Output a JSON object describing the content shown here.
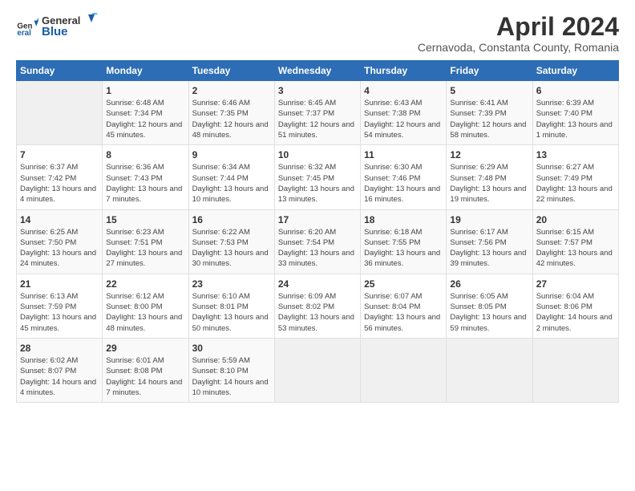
{
  "header": {
    "logo_general": "General",
    "logo_blue": "Blue",
    "month_title": "April 2024",
    "location": "Cernavoda, Constanta County, Romania"
  },
  "days_of_week": [
    "Sunday",
    "Monday",
    "Tuesday",
    "Wednesday",
    "Thursday",
    "Friday",
    "Saturday"
  ],
  "weeks": [
    [
      {
        "day": "",
        "sunrise": "",
        "sunset": "",
        "daylight": "",
        "empty": true
      },
      {
        "day": "1",
        "sunrise": "Sunrise: 6:48 AM",
        "sunset": "Sunset: 7:34 PM",
        "daylight": "Daylight: 12 hours and 45 minutes."
      },
      {
        "day": "2",
        "sunrise": "Sunrise: 6:46 AM",
        "sunset": "Sunset: 7:35 PM",
        "daylight": "Daylight: 12 hours and 48 minutes."
      },
      {
        "day": "3",
        "sunrise": "Sunrise: 6:45 AM",
        "sunset": "Sunset: 7:37 PM",
        "daylight": "Daylight: 12 hours and 51 minutes."
      },
      {
        "day": "4",
        "sunrise": "Sunrise: 6:43 AM",
        "sunset": "Sunset: 7:38 PM",
        "daylight": "Daylight: 12 hours and 54 minutes."
      },
      {
        "day": "5",
        "sunrise": "Sunrise: 6:41 AM",
        "sunset": "Sunset: 7:39 PM",
        "daylight": "Daylight: 12 hours and 58 minutes."
      },
      {
        "day": "6",
        "sunrise": "Sunrise: 6:39 AM",
        "sunset": "Sunset: 7:40 PM",
        "daylight": "Daylight: 13 hours and 1 minute."
      }
    ],
    [
      {
        "day": "7",
        "sunrise": "Sunrise: 6:37 AM",
        "sunset": "Sunset: 7:42 PM",
        "daylight": "Daylight: 13 hours and 4 minutes."
      },
      {
        "day": "8",
        "sunrise": "Sunrise: 6:36 AM",
        "sunset": "Sunset: 7:43 PM",
        "daylight": "Daylight: 13 hours and 7 minutes."
      },
      {
        "day": "9",
        "sunrise": "Sunrise: 6:34 AM",
        "sunset": "Sunset: 7:44 PM",
        "daylight": "Daylight: 13 hours and 10 minutes."
      },
      {
        "day": "10",
        "sunrise": "Sunrise: 6:32 AM",
        "sunset": "Sunset: 7:45 PM",
        "daylight": "Daylight: 13 hours and 13 minutes."
      },
      {
        "day": "11",
        "sunrise": "Sunrise: 6:30 AM",
        "sunset": "Sunset: 7:46 PM",
        "daylight": "Daylight: 13 hours and 16 minutes."
      },
      {
        "day": "12",
        "sunrise": "Sunrise: 6:29 AM",
        "sunset": "Sunset: 7:48 PM",
        "daylight": "Daylight: 13 hours and 19 minutes."
      },
      {
        "day": "13",
        "sunrise": "Sunrise: 6:27 AM",
        "sunset": "Sunset: 7:49 PM",
        "daylight": "Daylight: 13 hours and 22 minutes."
      }
    ],
    [
      {
        "day": "14",
        "sunrise": "Sunrise: 6:25 AM",
        "sunset": "Sunset: 7:50 PM",
        "daylight": "Daylight: 13 hours and 24 minutes."
      },
      {
        "day": "15",
        "sunrise": "Sunrise: 6:23 AM",
        "sunset": "Sunset: 7:51 PM",
        "daylight": "Daylight: 13 hours and 27 minutes."
      },
      {
        "day": "16",
        "sunrise": "Sunrise: 6:22 AM",
        "sunset": "Sunset: 7:53 PM",
        "daylight": "Daylight: 13 hours and 30 minutes."
      },
      {
        "day": "17",
        "sunrise": "Sunrise: 6:20 AM",
        "sunset": "Sunset: 7:54 PM",
        "daylight": "Daylight: 13 hours and 33 minutes."
      },
      {
        "day": "18",
        "sunrise": "Sunrise: 6:18 AM",
        "sunset": "Sunset: 7:55 PM",
        "daylight": "Daylight: 13 hours and 36 minutes."
      },
      {
        "day": "19",
        "sunrise": "Sunrise: 6:17 AM",
        "sunset": "Sunset: 7:56 PM",
        "daylight": "Daylight: 13 hours and 39 minutes."
      },
      {
        "day": "20",
        "sunrise": "Sunrise: 6:15 AM",
        "sunset": "Sunset: 7:57 PM",
        "daylight": "Daylight: 13 hours and 42 minutes."
      }
    ],
    [
      {
        "day": "21",
        "sunrise": "Sunrise: 6:13 AM",
        "sunset": "Sunset: 7:59 PM",
        "daylight": "Daylight: 13 hours and 45 minutes."
      },
      {
        "day": "22",
        "sunrise": "Sunrise: 6:12 AM",
        "sunset": "Sunset: 8:00 PM",
        "daylight": "Daylight: 13 hours and 48 minutes."
      },
      {
        "day": "23",
        "sunrise": "Sunrise: 6:10 AM",
        "sunset": "Sunset: 8:01 PM",
        "daylight": "Daylight: 13 hours and 50 minutes."
      },
      {
        "day": "24",
        "sunrise": "Sunrise: 6:09 AM",
        "sunset": "Sunset: 8:02 PM",
        "daylight": "Daylight: 13 hours and 53 minutes."
      },
      {
        "day": "25",
        "sunrise": "Sunrise: 6:07 AM",
        "sunset": "Sunset: 8:04 PM",
        "daylight": "Daylight: 13 hours and 56 minutes."
      },
      {
        "day": "26",
        "sunrise": "Sunrise: 6:05 AM",
        "sunset": "Sunset: 8:05 PM",
        "daylight": "Daylight: 13 hours and 59 minutes."
      },
      {
        "day": "27",
        "sunrise": "Sunrise: 6:04 AM",
        "sunset": "Sunset: 8:06 PM",
        "daylight": "Daylight: 14 hours and 2 minutes."
      }
    ],
    [
      {
        "day": "28",
        "sunrise": "Sunrise: 6:02 AM",
        "sunset": "Sunset: 8:07 PM",
        "daylight": "Daylight: 14 hours and 4 minutes."
      },
      {
        "day": "29",
        "sunrise": "Sunrise: 6:01 AM",
        "sunset": "Sunset: 8:08 PM",
        "daylight": "Daylight: 14 hours and 7 minutes."
      },
      {
        "day": "30",
        "sunrise": "Sunrise: 5:59 AM",
        "sunset": "Sunset: 8:10 PM",
        "daylight": "Daylight: 14 hours and 10 minutes."
      },
      {
        "day": "",
        "sunrise": "",
        "sunset": "",
        "daylight": "",
        "empty": true
      },
      {
        "day": "",
        "sunrise": "",
        "sunset": "",
        "daylight": "",
        "empty": true
      },
      {
        "day": "",
        "sunrise": "",
        "sunset": "",
        "daylight": "",
        "empty": true
      },
      {
        "day": "",
        "sunrise": "",
        "sunset": "",
        "daylight": "",
        "empty": true
      }
    ]
  ]
}
